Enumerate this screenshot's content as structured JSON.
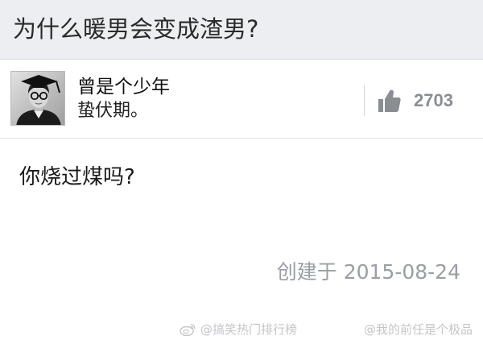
{
  "question": {
    "title": "为什么暖男会变成渣男?"
  },
  "answer": {
    "author_name": "曾是个少年",
    "author_bio": "蛰伏期。",
    "vote_count": "2703",
    "body": "你烧过煤吗?",
    "created_at": "创建于 2015-08-24"
  },
  "watermark": {
    "left_text": "@搞笑热门排行榜",
    "right_text": "@我的前任是个极品"
  },
  "icons": {
    "avatar": "avatar-photo",
    "vote": "thumbs-up-icon",
    "weibo": "weibo-icon"
  },
  "colors": {
    "question_bar_bg": "#eceef1",
    "vote_color": "#8a8d92",
    "timestamp_color": "#9a9da2"
  }
}
